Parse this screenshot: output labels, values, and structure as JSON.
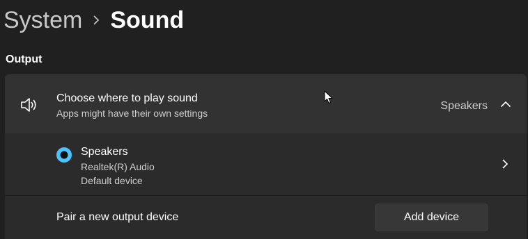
{
  "breadcrumb": {
    "parent": "System",
    "current": "Sound"
  },
  "output": {
    "section_title": "Output",
    "header": {
      "title": "Choose where to play sound",
      "subtitle": "Apps might have their own settings",
      "selected_value": "Speakers",
      "icon": "speaker-icon",
      "expanded": true
    },
    "devices": [
      {
        "name": "Speakers",
        "driver": "Realtek(R) Audio",
        "status": "Default device",
        "selected": true
      }
    ],
    "pair": {
      "label": "Pair a new output device",
      "button_label": "Add device"
    }
  },
  "colors": {
    "background": "#202020",
    "card": "#2b2b2b",
    "card_header": "#323232",
    "accent": "#4cc2ff",
    "button": "#373737"
  }
}
